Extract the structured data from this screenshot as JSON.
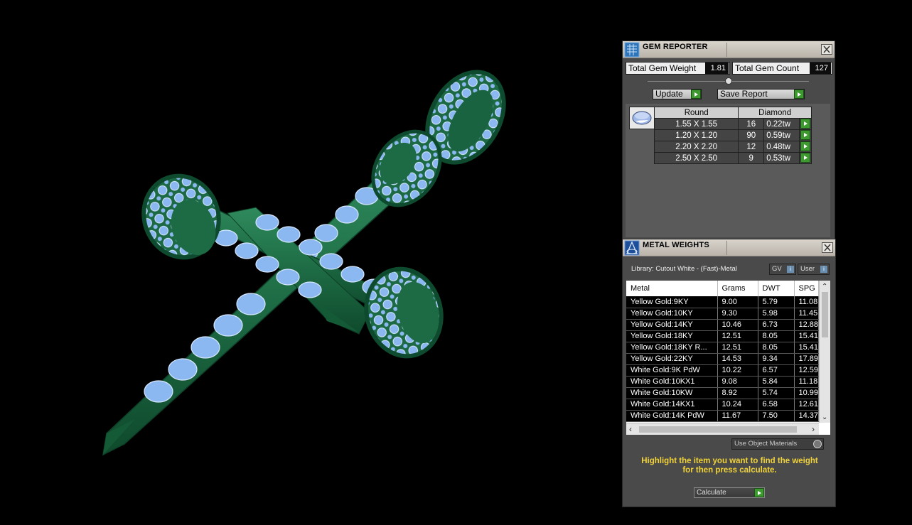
{
  "gem_reporter": {
    "title": "GEM REPORTER",
    "total_gem_weight_label": "Total Gem Weight",
    "total_gem_weight_value": "1.81",
    "total_gem_count_label": "Total Gem Count",
    "total_gem_count_value": "127",
    "update_label": "Update",
    "save_report_label": "Save Report",
    "table_headers": [
      "Round",
      "Diamond"
    ],
    "gems": [
      {
        "size": "1.55 X 1.55",
        "count": "16",
        "weight": "0.22tw"
      },
      {
        "size": "1.20 X 1.20",
        "count": "90",
        "weight": "0.59tw"
      },
      {
        "size": "2.20 X 2.20",
        "count": "12",
        "weight": "0.48tw"
      },
      {
        "size": "2.50 X 2.50",
        "count": "9",
        "weight": "0.53tw"
      }
    ]
  },
  "metal_weights": {
    "title": "METAL WEIGHTS",
    "library_label": "Library: Cutout White - (Fast)-Metal",
    "gv_label": "GV",
    "user_label": "User",
    "columns": [
      "Metal",
      "Grams",
      "DWT",
      "SPG"
    ],
    "rows": [
      {
        "metal": "Yellow Gold:9KY",
        "grams": "9.00",
        "dwt": "5.79",
        "spg": "11.08"
      },
      {
        "metal": "Yellow Gold:10KY",
        "grams": "9.30",
        "dwt": "5.98",
        "spg": "11.45"
      },
      {
        "metal": "Yellow Gold:14KY",
        "grams": "10.46",
        "dwt": "6.73",
        "spg": "12.88"
      },
      {
        "metal": "Yellow Gold:18KY",
        "grams": "12.51",
        "dwt": "8.05",
        "spg": "15.41"
      },
      {
        "metal": "Yellow Gold:18KY R...",
        "grams": "12.51",
        "dwt": "8.05",
        "spg": "15.41"
      },
      {
        "metal": "Yellow Gold:22KY",
        "grams": "14.53",
        "dwt": "9.34",
        "spg": "17.89"
      },
      {
        "metal": "White Gold:9K PdW",
        "grams": "10.22",
        "dwt": "6.57",
        "spg": "12.59"
      },
      {
        "metal": "White Gold:10KX1",
        "grams": "9.08",
        "dwt": "5.84",
        "spg": "11.18"
      },
      {
        "metal": "White Gold:10KW",
        "grams": "8.92",
        "dwt": "5.74",
        "spg": "10.99"
      },
      {
        "metal": "White Gold:14KX1",
        "grams": "10.24",
        "dwt": "6.58",
        "spg": "12.61"
      },
      {
        "metal": "White Gold:14K PdW",
        "grams": "11.67",
        "dwt": "7.50",
        "spg": "14.37"
      }
    ],
    "use_object_materials_label": "Use Object Materials",
    "hint_line1": "Highlight the item you want to find the weight",
    "hint_line2": "for then press calculate.",
    "calculate_label": "Calculate"
  },
  "colors": {
    "metal_green": "#1f6e47",
    "gem_blue": "#8cb8f2",
    "panel_bg": "#4a4a4a",
    "accent_green": "#3d9a2e",
    "hint_yellow": "#f0d23a"
  }
}
